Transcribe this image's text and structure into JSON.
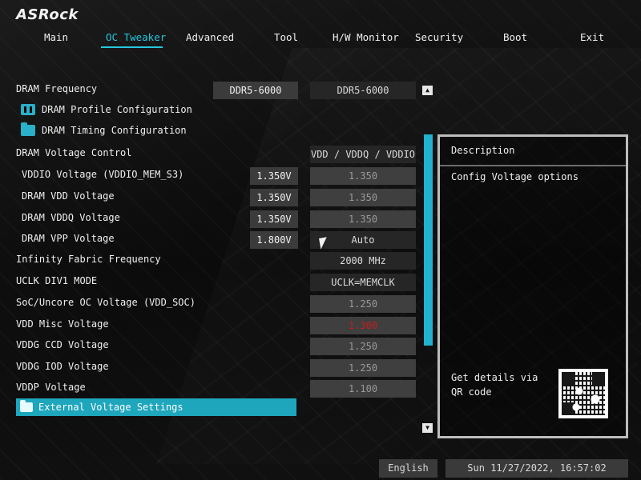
{
  "brand": {
    "logo_text": "ASRock"
  },
  "nav": {
    "tabs": [
      {
        "label": "Main"
      },
      {
        "label": "OC Tweaker"
      },
      {
        "label": "Advanced"
      },
      {
        "label": "Tool"
      },
      {
        "label": "H/W Monitor"
      },
      {
        "label": "Security"
      },
      {
        "label": "Boot"
      },
      {
        "label": "Exit"
      }
    ],
    "active_tab": "OC Tweaker"
  },
  "settings": {
    "dram_frequency": {
      "label": "DRAM Frequency",
      "current": "DDR5-6000",
      "value": "DDR5-6000"
    },
    "dram_profile_config": {
      "label": "DRAM Profile Configuration"
    },
    "dram_timing_config": {
      "label": "DRAM Timing Configuration"
    },
    "dram_voltage_control": {
      "label": "DRAM Voltage Control",
      "value": "VDD / VDDQ / VDDIO"
    },
    "vddio_voltage": {
      "label": "VDDIO Voltage (VDDIO_MEM_S3)",
      "current": "1.350V",
      "value": "1.350"
    },
    "dram_vdd_voltage": {
      "label": "DRAM VDD Voltage",
      "current": "1.350V",
      "value": "1.350"
    },
    "dram_vddq_voltage": {
      "label": "DRAM VDDQ Voltage",
      "current": "1.350V",
      "value": "1.350"
    },
    "dram_vpp_voltage": {
      "label": "DRAM VPP Voltage",
      "current": "1.800V",
      "value": "Auto"
    },
    "infinity_fabric_frequency": {
      "label": "Infinity Fabric Frequency",
      "value": "2000 MHz"
    },
    "uclk_div1_mode": {
      "label": "UCLK DIV1 MODE",
      "value": "UCLK=MEMCLK"
    },
    "soc_uncore_oc_voltage": {
      "label": "SoC/Uncore OC Voltage (VDD_SOC)",
      "value": "1.250"
    },
    "vdd_misc_voltage": {
      "label": "VDD Misc Voltage",
      "value": "1.300"
    },
    "vddg_ccd_voltage": {
      "label": "VDDG CCD Voltage",
      "value": "1.250"
    },
    "vddg_iod_voltage": {
      "label": "VDDG IOD Voltage",
      "value": "1.250"
    },
    "vddp_voltage": {
      "label": "VDDP Voltage",
      "value": "1.100"
    },
    "external_voltage_settings": {
      "label": "External Voltage Settings"
    }
  },
  "description_panel": {
    "title": "Description",
    "text": "Config Voltage options",
    "qr_text": "Get details via QR code"
  },
  "status_bar": {
    "language": "English",
    "datetime": "Sun 11/27/2022, 16:57:02"
  },
  "colors": {
    "accent": "#27c7df",
    "selected_row": "#1ea6bd",
    "warning_text": "#c81d1d"
  },
  "icons": {
    "scroll_up": "▲",
    "scroll_down": "▼",
    "folder": "folder-icon",
    "profile": "profile-icon"
  }
}
